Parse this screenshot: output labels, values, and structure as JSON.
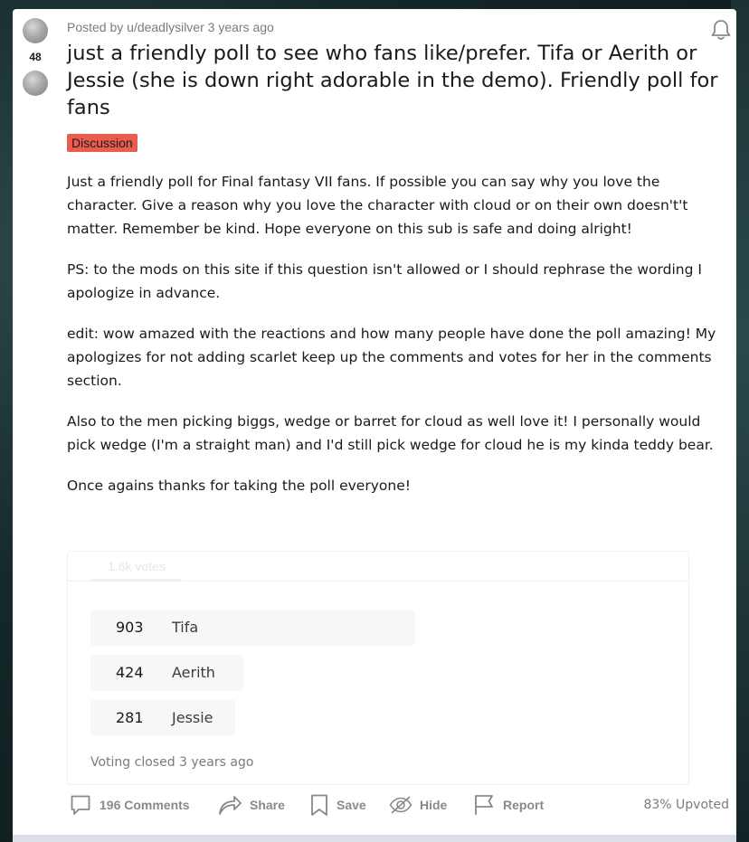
{
  "post": {
    "meta": "Posted by u/deadlysilver 3 years ago",
    "score": "48",
    "title": "just a friendly poll to see who fans like/prefer. Tifa or Aerith or Jessie (she is down right adorable in the demo). Friendly poll for fans",
    "flair": "Discussion",
    "flair_color": "#ea5c50",
    "paragraphs": [
      "Just a friendly poll for Final fantasy VII fans. If possible you can say why you love the character. Give a reason why you love the character with cloud or on their own doesn't't matter. Remember be kind. Hope everyone on this sub is safe and doing alright!",
      "PS: to the mods on this site if this question isn't allowed or I should rephrase the wording I apologize in advance.",
      "edit: wow amazed with the reactions and how many people have done the poll amazing! My apologizes for not adding scarlet keep up the comments and votes for her in the comments section.",
      "Also to the men picking biggs, wedge or barret for cloud as well love it! I personally would pick wedge (I'm a straight man) and I'd still pick wedge for cloud he is my kinda teddy bear.",
      "Once agains thanks for taking the poll everyone!"
    ]
  },
  "poll": {
    "total": "1.6k votes",
    "options": [
      {
        "count": "903",
        "label": "Tifa",
        "votes": 903
      },
      {
        "count": "424",
        "label": "Aerith",
        "votes": 424
      },
      {
        "count": "281",
        "label": "Jessie",
        "votes": 281
      }
    ],
    "status": "Voting closed 3 years ago"
  },
  "actions": {
    "comments": "196 Comments",
    "share": "Share",
    "save": "Save",
    "hide": "Hide",
    "report": "Report",
    "upvoted": "83% Upvoted"
  },
  "icons": [
    "upvote-icon",
    "downvote-icon",
    "bell-icon",
    "comment-icon",
    "share-icon",
    "save-icon",
    "hide-icon",
    "report-icon"
  ]
}
